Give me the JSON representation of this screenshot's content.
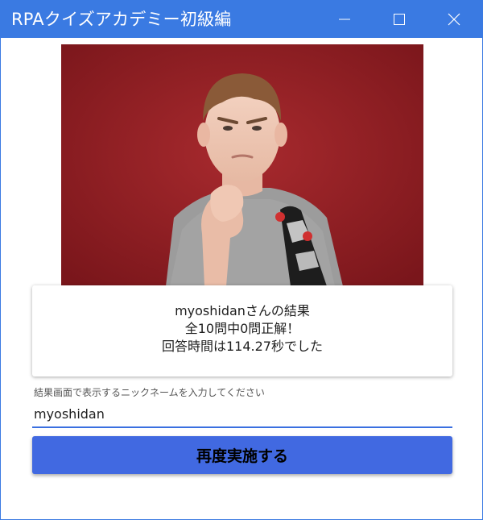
{
  "window": {
    "title": "RPAクイズアカデミー初級編",
    "accent_color": "#3a7ae2",
    "controls": {
      "minimize_icon": "minimize-icon",
      "maximize_icon": "maximize-icon",
      "close_icon": "close-icon"
    }
  },
  "result": {
    "line1": "myoshidanさんの結果",
    "line2": "全10問中0問正解！",
    "line3": "回答時間は114.27秒でした"
  },
  "nickname": {
    "label": "結果画面で表示するニックネームを入力してください",
    "value": "myoshidan",
    "underline_color": "#3a6fe0"
  },
  "retry_button": {
    "label": "再度実施する",
    "color": "#4169e1"
  }
}
